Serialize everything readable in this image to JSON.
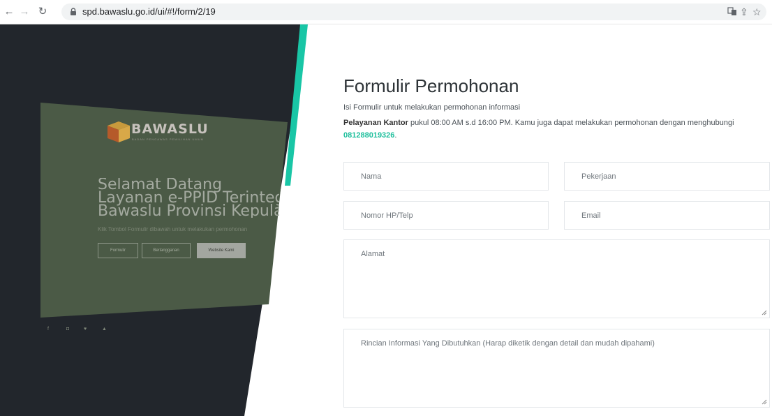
{
  "browser": {
    "back_icon": "arrow-left-icon",
    "forward_icon": "arrow-right-icon",
    "reload_icon": "reload-icon",
    "url": "spd.bawaslu.go.id/ui/#!/form/2/19"
  },
  "hero": {
    "logo_text": "BAWASLU",
    "logo_sub": "BADAN PENGAWAS PEMILIHAN UMUM",
    "title_lines": [
      "Selamat Datang",
      "Layanan e-PPID Terintegrasi",
      "Bawaslu Provinsi Kepulauan"
    ],
    "note": "Klik Tombol Formulir dibawah untuk melakukan permohonan",
    "buttons": [
      "Formulir",
      "Berlangganan",
      "Website Kami"
    ],
    "colors": {
      "dark": "#22262c",
      "green": "#4b5a46",
      "accent": "#19c6a6"
    }
  },
  "form": {
    "title": "Formulir Permohonan",
    "subtitle": "Isi Formulir untuk melakukan permohonan informasi",
    "office_label": "Pelayanan Kantor",
    "office_text": " pukul 08:00 AM s.d 16:00 PM. Kamu juga dapat melakukan permohonan dengan menghubungi ",
    "phone": "081288019326",
    "phone_suffix": ".",
    "fields": {
      "nama": "Nama",
      "pekerjaan": "Pekerjaan",
      "nomor": "Nomor HP/Telp",
      "email": "Email",
      "alamat": "Alamat",
      "rincian": "Rincian Informasi Yang Dibutuhkan (Harap diketik dengan detail dan mudah dipahami)"
    },
    "accent_color": "#1dbf9c"
  }
}
